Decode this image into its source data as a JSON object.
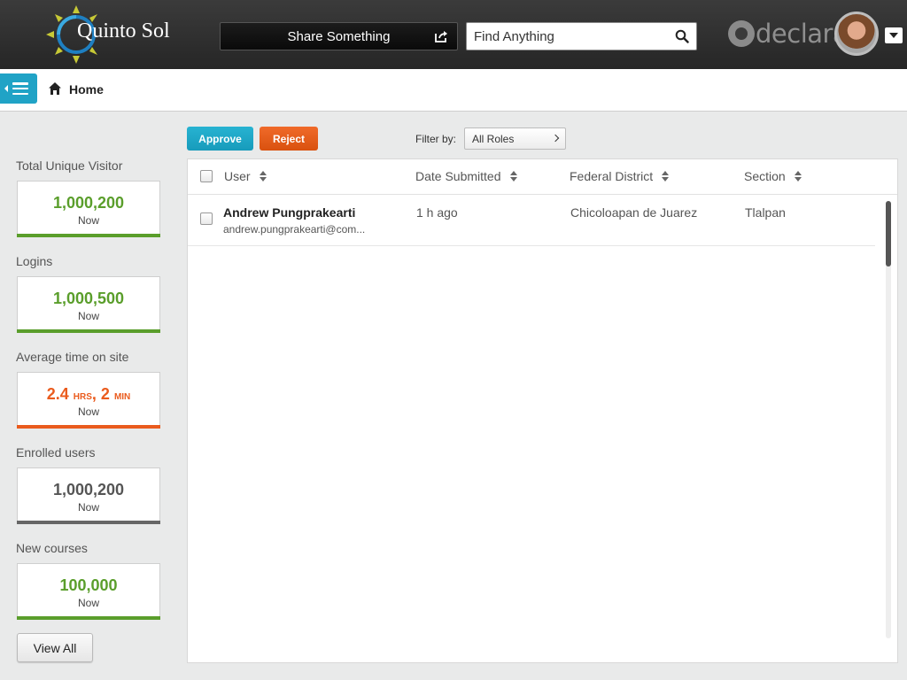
{
  "header": {
    "logo_text": "Quinto Sol",
    "share_label": "Share Something",
    "search_placeholder": "Find Anything",
    "brand_text": "declara"
  },
  "breadcrumb": {
    "home_label": "Home"
  },
  "stats": [
    {
      "label": "Total Unique Visitor",
      "value": "1,000,200",
      "sub": "Now",
      "color": "#5a9e2b"
    },
    {
      "label": "Logins",
      "value": "1,000,500",
      "sub": "Now",
      "color": "#5a9e2b"
    },
    {
      "label": "Average time on site",
      "value_hrs": "2.4",
      "unit_hrs": "HRS",
      "value_min": "2",
      "unit_min": "MIN",
      "sub": "Now",
      "color": "#ea5b1d"
    },
    {
      "label": "Enrolled users",
      "value": "1,000,200",
      "sub": "Now",
      "color": "#555555"
    },
    {
      "label": "New courses",
      "value": "100,000",
      "sub": "Now",
      "color": "#5a9e2b"
    }
  ],
  "view_all_label": "View All",
  "toolbar": {
    "approve_label": "Approve",
    "reject_label": "Reject",
    "filter_label": "Filter by:",
    "filter_value": "All Roles"
  },
  "table": {
    "columns": [
      "User",
      "Date Submitted",
      "Federal District",
      "Section"
    ],
    "rows": [
      {
        "name": "Andrew Pungprakearti",
        "email": "andrew.pungprakearti@com...",
        "date": "1 h ago",
        "district": "Chicoloapan de Juarez",
        "section": "Tlalpan"
      }
    ]
  },
  "colors": {
    "accent": "#20a3c6",
    "approve": "#1aa5c4",
    "reject": "#e65a18",
    "positive": "#5a9e2b"
  }
}
